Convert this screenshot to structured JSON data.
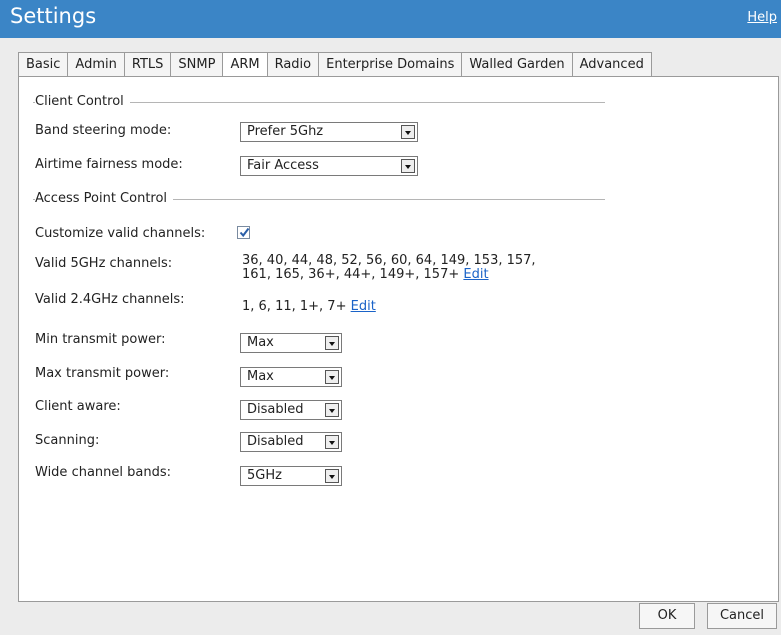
{
  "header": {
    "title": "Settings",
    "help_label": "Help"
  },
  "tabs": [
    {
      "label": "Basic"
    },
    {
      "label": "Admin"
    },
    {
      "label": "RTLS"
    },
    {
      "label": "SNMP"
    },
    {
      "label": "ARM",
      "active": true
    },
    {
      "label": "Radio"
    },
    {
      "label": "Enterprise Domains"
    },
    {
      "label": "Walled Garden"
    },
    {
      "label": "Advanced"
    }
  ],
  "client_control": {
    "legend": "Client Control",
    "band_steering": {
      "label": "Band steering mode:",
      "value": "Prefer 5Ghz"
    },
    "airtime_fairness": {
      "label": "Airtime fairness mode:",
      "value": "Fair Access"
    }
  },
  "ap_control": {
    "legend": "Access Point Control",
    "customize_channels": {
      "label": "Customize valid channels:",
      "checked": true
    },
    "valid_5ghz": {
      "label": "Valid 5GHz channels:",
      "line1": "36, 40, 44, 48, 52, 56, 60, 64, 149, 153, 157,",
      "line2": "161, 165, 36+, 44+, 149+, 157+",
      "edit": "Edit"
    },
    "valid_24ghz": {
      "label": "Valid 2.4GHz channels:",
      "value": "1, 6, 11, 1+, 7+",
      "edit": "Edit"
    },
    "min_power": {
      "label": "Min transmit power:",
      "value": "Max"
    },
    "max_power": {
      "label": "Max transmit power:",
      "value": "Max"
    },
    "client_aware": {
      "label": "Client aware:",
      "value": "Disabled"
    },
    "scanning": {
      "label": "Scanning:",
      "value": "Disabled"
    },
    "wide_bands": {
      "label": "Wide channel bands:",
      "value": "5GHz"
    }
  },
  "footer": {
    "ok_label": "OK",
    "cancel_label": "Cancel"
  }
}
